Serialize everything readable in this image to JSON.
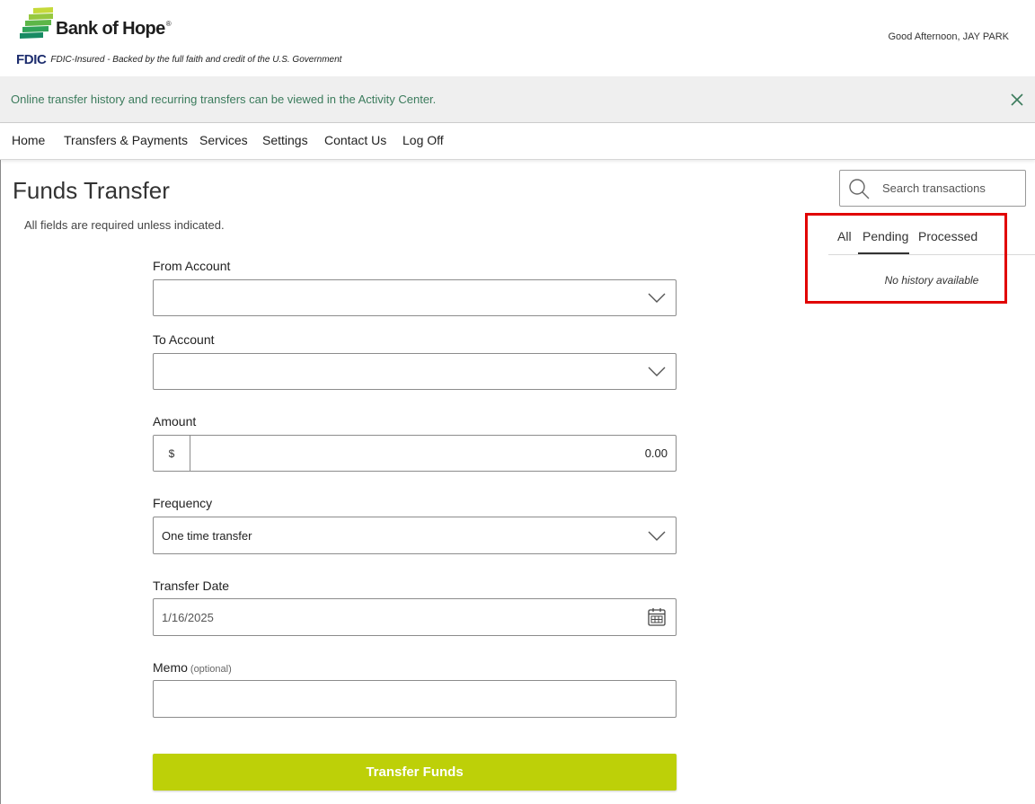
{
  "header": {
    "logo_icon": "bank-of-hope-logo-icon",
    "bank_name": "Bank of Hope",
    "registered_mark": "®",
    "fdic_mark": "FDIC",
    "fdic_text": "FDIC-Insured - Backed by the full faith and credit of the U.S. Government",
    "greeting": "Good Afternoon, JAY PARK"
  },
  "banner": {
    "text": "Online transfer history and recurring transfers can be viewed in the Activity Center.",
    "close_icon": "close-icon"
  },
  "nav": {
    "items": [
      {
        "label": "Home"
      },
      {
        "label": "Transfers & Payments"
      },
      {
        "label": "Services"
      },
      {
        "label": "Settings"
      },
      {
        "label": "Contact Us"
      },
      {
        "label": "Log Off"
      }
    ]
  },
  "page": {
    "title": "Funds Transfer",
    "required_note": "All fields are required unless indicated."
  },
  "form": {
    "from_account": {
      "label": "From Account",
      "value": "",
      "icon": "chevron-down-icon"
    },
    "to_account": {
      "label": "To Account",
      "value": "",
      "icon": "chevron-down-icon"
    },
    "amount": {
      "label": "Amount",
      "currency_symbol": "$",
      "value": "0.00"
    },
    "frequency": {
      "label": "Frequency",
      "value": "One time transfer",
      "icon": "chevron-down-icon"
    },
    "transfer_date": {
      "label": "Transfer Date",
      "value": "1/16/2025",
      "icon": "calendar-icon"
    },
    "memo": {
      "label": "Memo",
      "optional_tag": "(optional)",
      "value": ""
    },
    "submit_label": "Transfer Funds"
  },
  "history": {
    "search_icon": "search-icon",
    "search_placeholder": "Search transactions",
    "search_value": "",
    "tabs": [
      {
        "label": "All",
        "active": false
      },
      {
        "label": "Pending",
        "active": true
      },
      {
        "label": "Processed",
        "active": false
      }
    ],
    "empty_message": "No history available"
  },
  "colors": {
    "brand_navy": "#1d2d6e",
    "banner_background": "#efefef",
    "banner_text": "#3b7b5c",
    "button_background": "#bdd008",
    "button_text": "#ffffff",
    "highlight_border": "#e10000",
    "active_tab_indicator": "#333333"
  }
}
